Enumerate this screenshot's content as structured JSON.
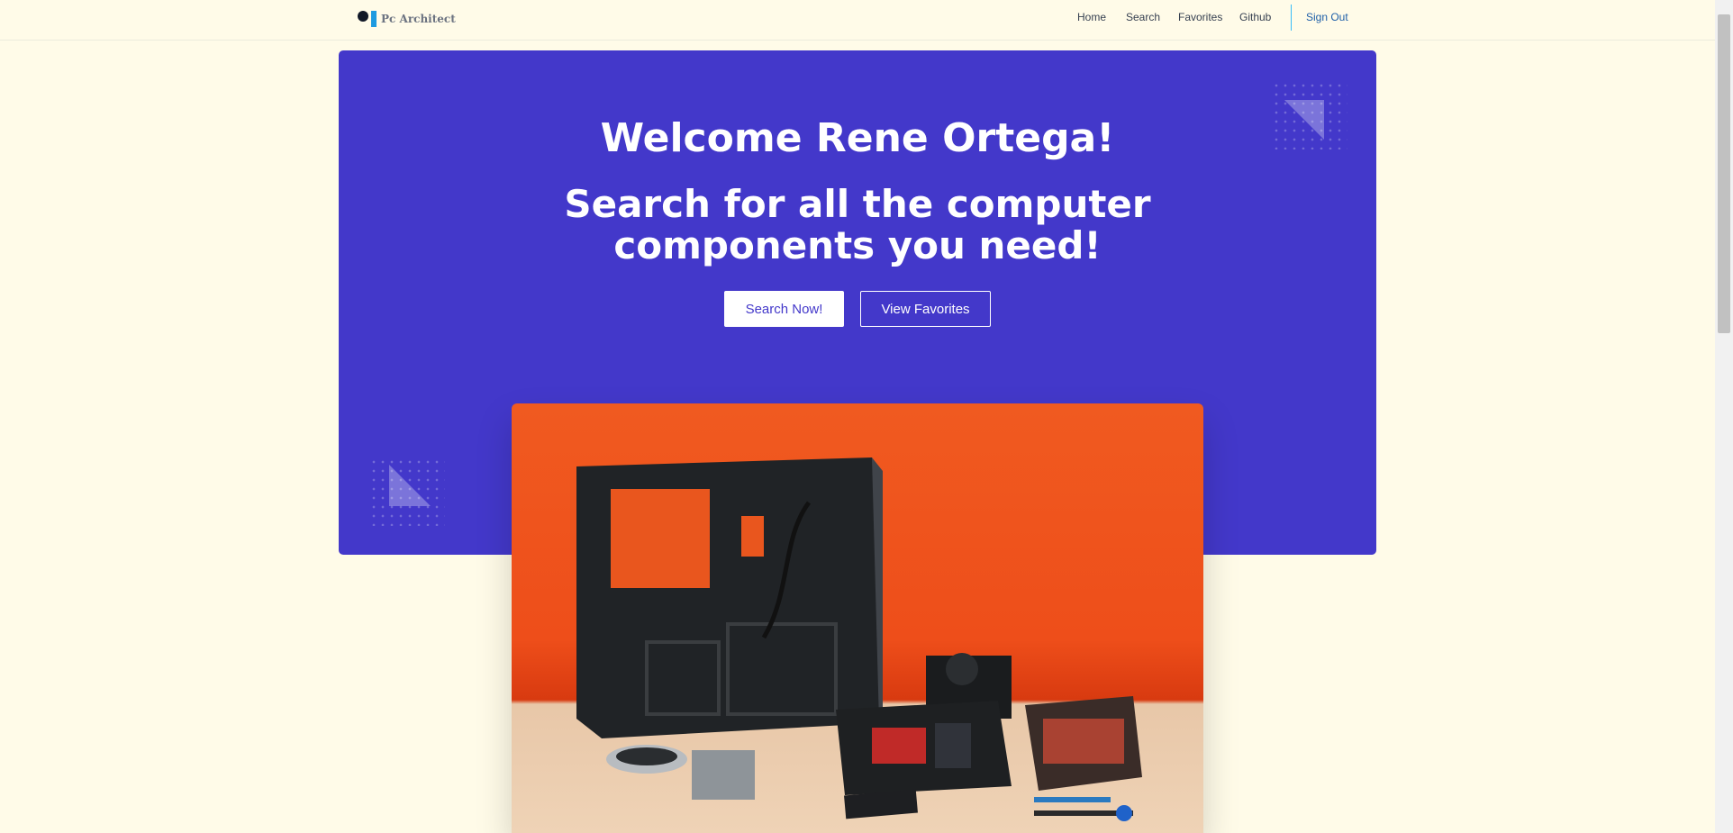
{
  "brand": {
    "name": "Pc Architect"
  },
  "nav": {
    "items": [
      {
        "label": "Home"
      },
      {
        "label": "Search"
      },
      {
        "label": "Favorites"
      },
      {
        "label": "Github"
      }
    ],
    "sign_out": "Sign Out"
  },
  "hero": {
    "welcome": "Welcome Rene Ortega!",
    "headline_line1": "Search for all the computer",
    "headline_line2": "components you need!",
    "primary_button": "Search Now!",
    "secondary_button": "View Favorites"
  },
  "colors": {
    "page_background": "#fffbe8",
    "hero_background": "#4338ca",
    "accent_blue": "#1e9be0"
  },
  "icons": [
    "logo-mark"
  ]
}
